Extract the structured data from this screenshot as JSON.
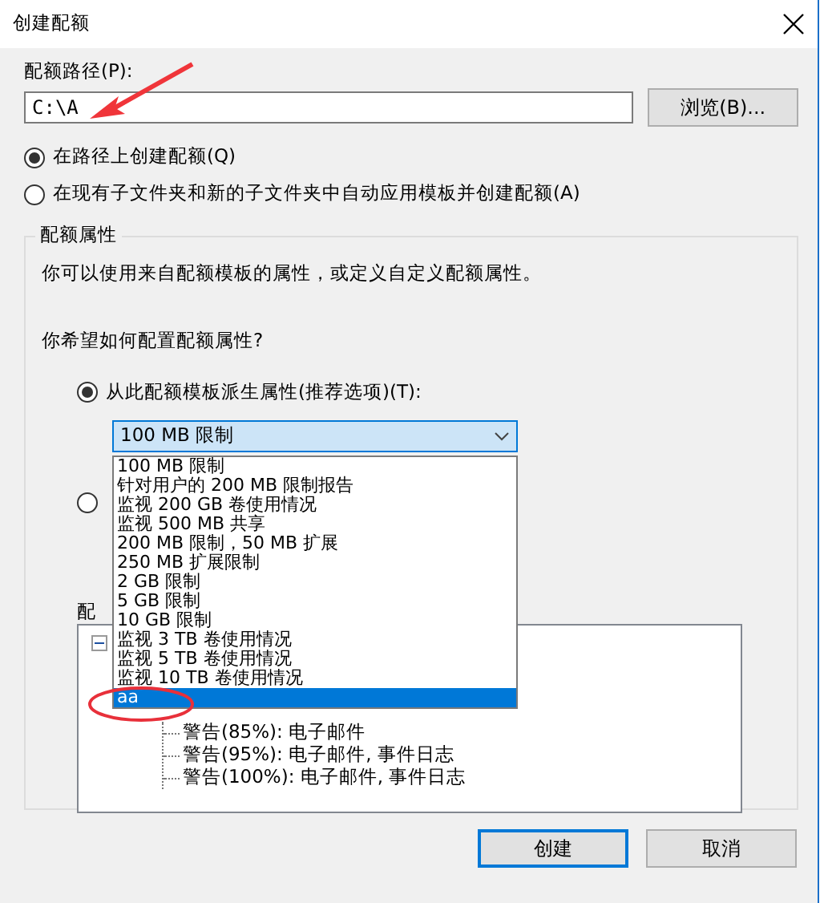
{
  "window": {
    "title": "创建配额"
  },
  "path": {
    "label": "配额路径(P):",
    "value": "C:\\A"
  },
  "browse_button": "浏览(B)...",
  "create_mode": [
    {
      "label": "在路径上创建配额(Q)",
      "selected": true
    },
    {
      "label": "在现有子文件夹和新的子文件夹中自动应用模板并创建配额(A)",
      "selected": false
    }
  ],
  "properties_group": {
    "title": "配额属性",
    "description": "你可以使用来自配额模板的属性，或定义自定义配额属性。",
    "question": "你希望如何配置配额属性?",
    "options": [
      {
        "label": "从此配额模板派生属性(推荐选项)(T):",
        "selected": true
      },
      {
        "selected": false
      }
    ],
    "template_combo": {
      "value": "100 MB 限制",
      "expanded": true
    },
    "template_list": [
      {
        "label": "100 MB 限制",
        "selected": false
      },
      {
        "label": "针对用户的 200 MB 限制报告",
        "selected": false
      },
      {
        "label": "监视 200 GB 卷使用情况",
        "selected": false
      },
      {
        "label": "监视 500 MB 共享",
        "selected": false
      },
      {
        "label": "200 MB 限制，50 MB 扩展",
        "selected": false
      },
      {
        "label": "250 MB 扩展限制",
        "selected": false
      },
      {
        "label": "2 GB 限制",
        "selected": false
      },
      {
        "label": "5 GB 限制",
        "selected": false
      },
      {
        "label": "10 GB 限制",
        "selected": false
      },
      {
        "label": "监视 3 TB 卷使用情况",
        "selected": false
      },
      {
        "label": "监视 5 TB 卷使用情况",
        "selected": false
      },
      {
        "label": "监视 10 TB 卷使用情况",
        "selected": false
      },
      {
        "label": "aa",
        "selected": true
      }
    ],
    "summary_label": "配",
    "summary_tree": [
      {
        "expanded": true,
        "children": [
          {
            "label": "警告(85%): 电子邮件"
          },
          {
            "label": "警告(95%): 电子邮件, 事件日志"
          },
          {
            "label": "警告(100%): 电子邮件, 事件日志"
          }
        ]
      }
    ]
  },
  "buttons": [
    {
      "label": "创建",
      "default": true
    },
    {
      "label": "取消",
      "default": false
    }
  ]
}
